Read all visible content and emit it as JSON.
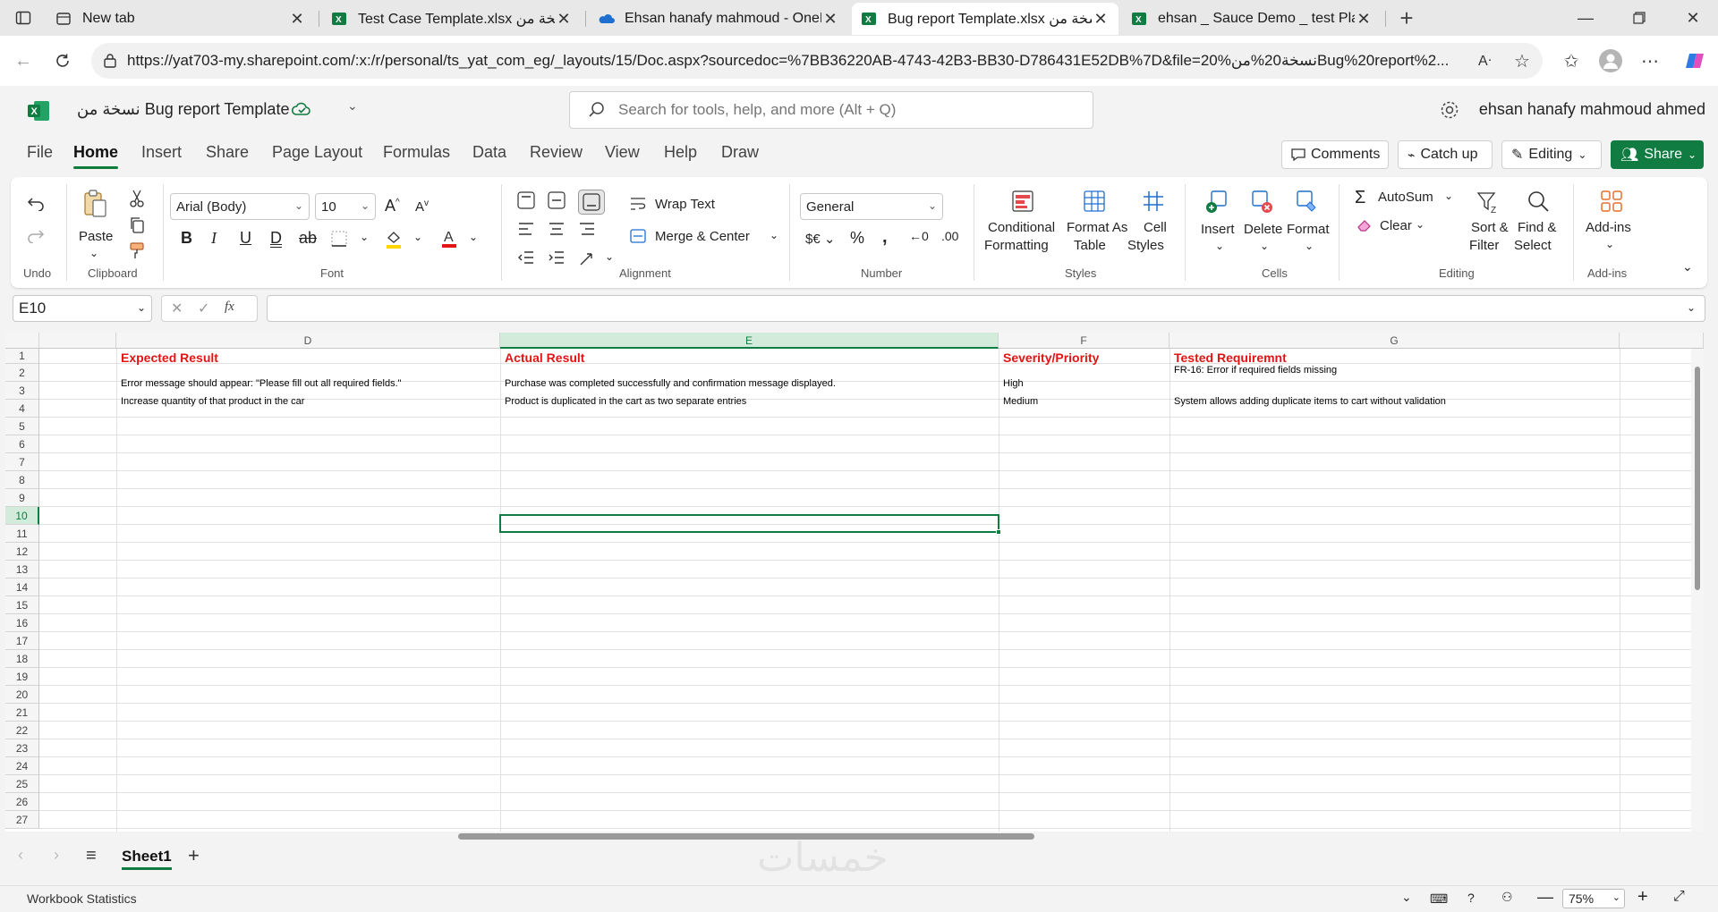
{
  "browser": {
    "tabs": [
      {
        "label": "New tab",
        "icon": "newtab-icon",
        "active": false
      },
      {
        "label": "Test Case Template.xlsx نسخة من",
        "icon": "excel-icon",
        "active": false
      },
      {
        "label": "Ehsan hanafy mahmoud - OneDri",
        "icon": "onedrive-icon",
        "active": false
      },
      {
        "label": "Bug report Template.xlsx نسخة من",
        "icon": "excel-icon",
        "active": true
      },
      {
        "label": "ehsan _ Sauce Demo _ test Plan.xl",
        "icon": "excel-icon",
        "active": false
      }
    ],
    "url": "https://yat703-my.sharepoint.com/:x:/r/personal/ts_yat_com_eg/_layouts/15/Doc.aspx?sourcedoc=%7BB36220AB-4743-42B3-BB30-D786431E52DB%7D&file=20%نسخة20%منBug%20report%2..."
  },
  "excel": {
    "doc_title": "نسخة من Bug report Template",
    "search_placeholder": "Search for tools, help, and more (Alt + Q)",
    "user_name": "ehsan hanafy mahmoud ahmed",
    "menu": [
      "File",
      "Home",
      "Insert",
      "Share",
      "Page Layout",
      "Formulas",
      "Data",
      "Review",
      "View",
      "Help",
      "Draw"
    ],
    "menu_selected": "Home",
    "top_buttons": {
      "comments": "Comments",
      "catch_up": "Catch up",
      "editing": "Editing",
      "share": "Share"
    },
    "accent": "#107c41"
  },
  "ribbon": {
    "groups": {
      "undo": "Undo",
      "clipboard": "Clipboard",
      "font": "Font",
      "alignment": "Alignment",
      "number": "Number",
      "styles": "Styles",
      "cells": "Cells",
      "editing": "Editing",
      "addins": "Add-ins"
    },
    "paste": "Paste",
    "font_name": "Arial (Body)",
    "font_size": "10",
    "wrap_text": "Wrap Text",
    "merge_center": "Merge & Center",
    "number_format": "General",
    "conditional_formatting": [
      "Conditional",
      "Formatting"
    ],
    "format_as_table": [
      "Format As",
      "Table"
    ],
    "cell_styles": [
      "Cell",
      "Styles"
    ],
    "insert": "Insert",
    "delete": "Delete",
    "format": "Format",
    "autosum": "AutoSum",
    "clear": "Clear",
    "sort_filter": [
      "Sort &",
      "Filter"
    ],
    "find_select": [
      "Find &",
      "Select"
    ],
    "addins": "Add-ins"
  },
  "formula_bar": {
    "name_box": "E10",
    "formula": ""
  },
  "sheet": {
    "columns": [
      "D",
      "E",
      "F",
      "G"
    ],
    "selected_column": "E",
    "selected_row": 10,
    "row_count": 27,
    "rows": [
      {
        "row": 1,
        "D": "Expected Result",
        "E": "Actual Result",
        "F": "Severity/Priority",
        "G": "Tested Requiremnt"
      },
      {
        "row": 2,
        "D": "Error message should appear: \"Please fill out all required fields.\"",
        "E": "Purchase was completed successfully and confirmation message displayed.",
        "F": "High",
        "G": "FR-16: Error if required fields missing"
      },
      {
        "row": 3,
        "D": "Increase quantity of that product in the car",
        "E": "Product is duplicated in the cart as two separate entries",
        "F": "Medium",
        "G": "System allows adding duplicate items to cart without validation"
      }
    ],
    "header_color": "#e31414"
  },
  "sheet_tabs": {
    "active": "Sheet1"
  },
  "status": {
    "label": "Workbook Statistics",
    "zoom": "75%"
  },
  "watermark": "خمسات"
}
